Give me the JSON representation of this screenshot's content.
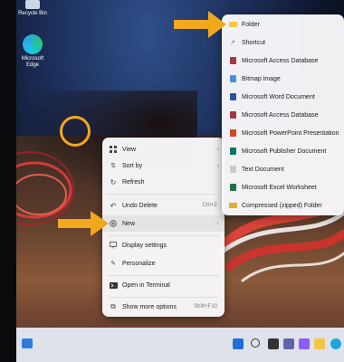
{
  "desktop": {
    "recycle_label": "Recycle Bin",
    "edge_label": "Microsoft Edge"
  },
  "context_menu": {
    "items": [
      {
        "label": "View",
        "icon": "grid-icon",
        "submenu": true
      },
      {
        "label": "Sort by",
        "icon": "sort-icon",
        "submenu": true
      },
      {
        "label": "Refresh",
        "icon": "refresh-icon"
      },
      {
        "label": "Undo Delete",
        "icon": "undo-icon",
        "shortcut": "Ctrl+Z"
      },
      {
        "label": "New",
        "icon": "plus-circle-icon",
        "submenu": true
      },
      {
        "label": "Display settings",
        "icon": "display-icon"
      },
      {
        "label": "Personalize",
        "icon": "brush-icon"
      },
      {
        "label": "Open in Terminal",
        "icon": "terminal-icon"
      },
      {
        "label": "Show more options",
        "icon": "more-icon",
        "shortcut": "Shift+F10"
      }
    ]
  },
  "new_submenu": {
    "items": [
      {
        "label": "Folder",
        "color": "#f2c744"
      },
      {
        "label": "Shortcut",
        "color": "#3a7bd5"
      },
      {
        "label": "Microsoft Access Database",
        "color": "#a4373a"
      },
      {
        "label": "Bitmap image",
        "color": "#4a90d9"
      },
      {
        "label": "Microsoft Word Document",
        "color": "#2b579a"
      },
      {
        "label": "Microsoft Access Database",
        "color": "#a4373a"
      },
      {
        "label": "Microsoft PowerPoint Presentation",
        "color": "#d24726"
      },
      {
        "label": "Microsoft Publisher Document",
        "color": "#077568"
      },
      {
        "label": "Text Document",
        "color": "#9aa0a6"
      },
      {
        "label": "Microsoft Excel Worksheet",
        "color": "#217346"
      },
      {
        "label": "Compressed (zipped) Folder",
        "color": "#e0b030"
      }
    ]
  },
  "accent": "#f2a81d"
}
